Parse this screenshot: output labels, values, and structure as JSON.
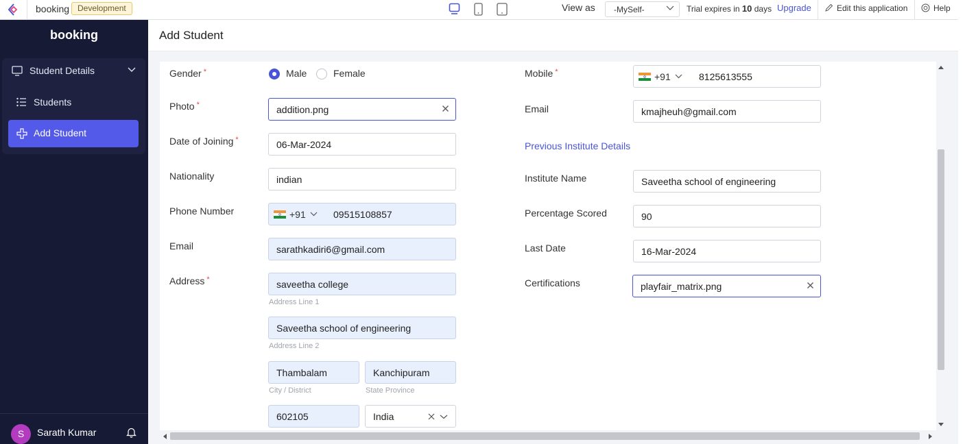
{
  "topbar": {
    "app_name": "booking",
    "env_badge": "Development",
    "view_as_label": "View as",
    "view_as_value": "-MySelf-",
    "trial_prefix": "Trial expires in",
    "trial_days": "10",
    "trial_suffix": "days",
    "upgrade": "Upgrade",
    "edit_app": "Edit this application",
    "help": "Help"
  },
  "sidebar": {
    "brand": "booking",
    "section_label": "Student Details",
    "items": [
      {
        "label": "Students",
        "icon": "list-icon",
        "active": false
      },
      {
        "label": "Add Student",
        "icon": "plus-icon",
        "active": true
      }
    ],
    "user_initial": "S",
    "user_name": "Sarath Kumar"
  },
  "page": {
    "title": "Add Student"
  },
  "form": {
    "left": {
      "gender_label": "Gender",
      "gender_options": [
        "Male",
        "Female"
      ],
      "gender_selected": "Male",
      "photo_label": "Photo",
      "photo_value": "addition.png",
      "doj_label": "Date of Joining",
      "doj_value": "06-Mar-2024",
      "nationality_label": "Nationality",
      "nationality_value": "indian",
      "phone_label": "Phone Number",
      "phone_code": "+91",
      "phone_value": "09515108857",
      "email_label": "Email",
      "email_value": "sarathkadiri6@gmail.com",
      "address_label": "Address",
      "address_line1": "saveetha college",
      "address_line1_hint": "Address Line 1",
      "address_line2": "Saveetha school of engineering",
      "address_line2_hint": "Address Line 2",
      "city": "Thambalam",
      "city_hint": "City / District",
      "state": "Kanchipuram",
      "state_hint": "State Province",
      "postal": "602105",
      "country": "India"
    },
    "right": {
      "mobile_label": "Mobile",
      "mobile_code": "+91",
      "mobile_value": "8125613555",
      "email_label": "Email",
      "email_value": "kmajheuh@gmail.com",
      "section_title": "Previous Institute Details",
      "institute_label": "Institute Name",
      "institute_value": "Saveetha school of engineering",
      "percentage_label": "Percentage Scored",
      "percentage_value": "90",
      "last_date_label": "Last Date",
      "last_date_value": "16-Mar-2024",
      "cert_label": "Certifications",
      "cert_value": "playfair_matrix.png"
    }
  },
  "colors": {
    "accent": "#4a55d6",
    "sidebar_bg": "#161a34",
    "active_item": "#5359e8",
    "required": "#e04848"
  }
}
